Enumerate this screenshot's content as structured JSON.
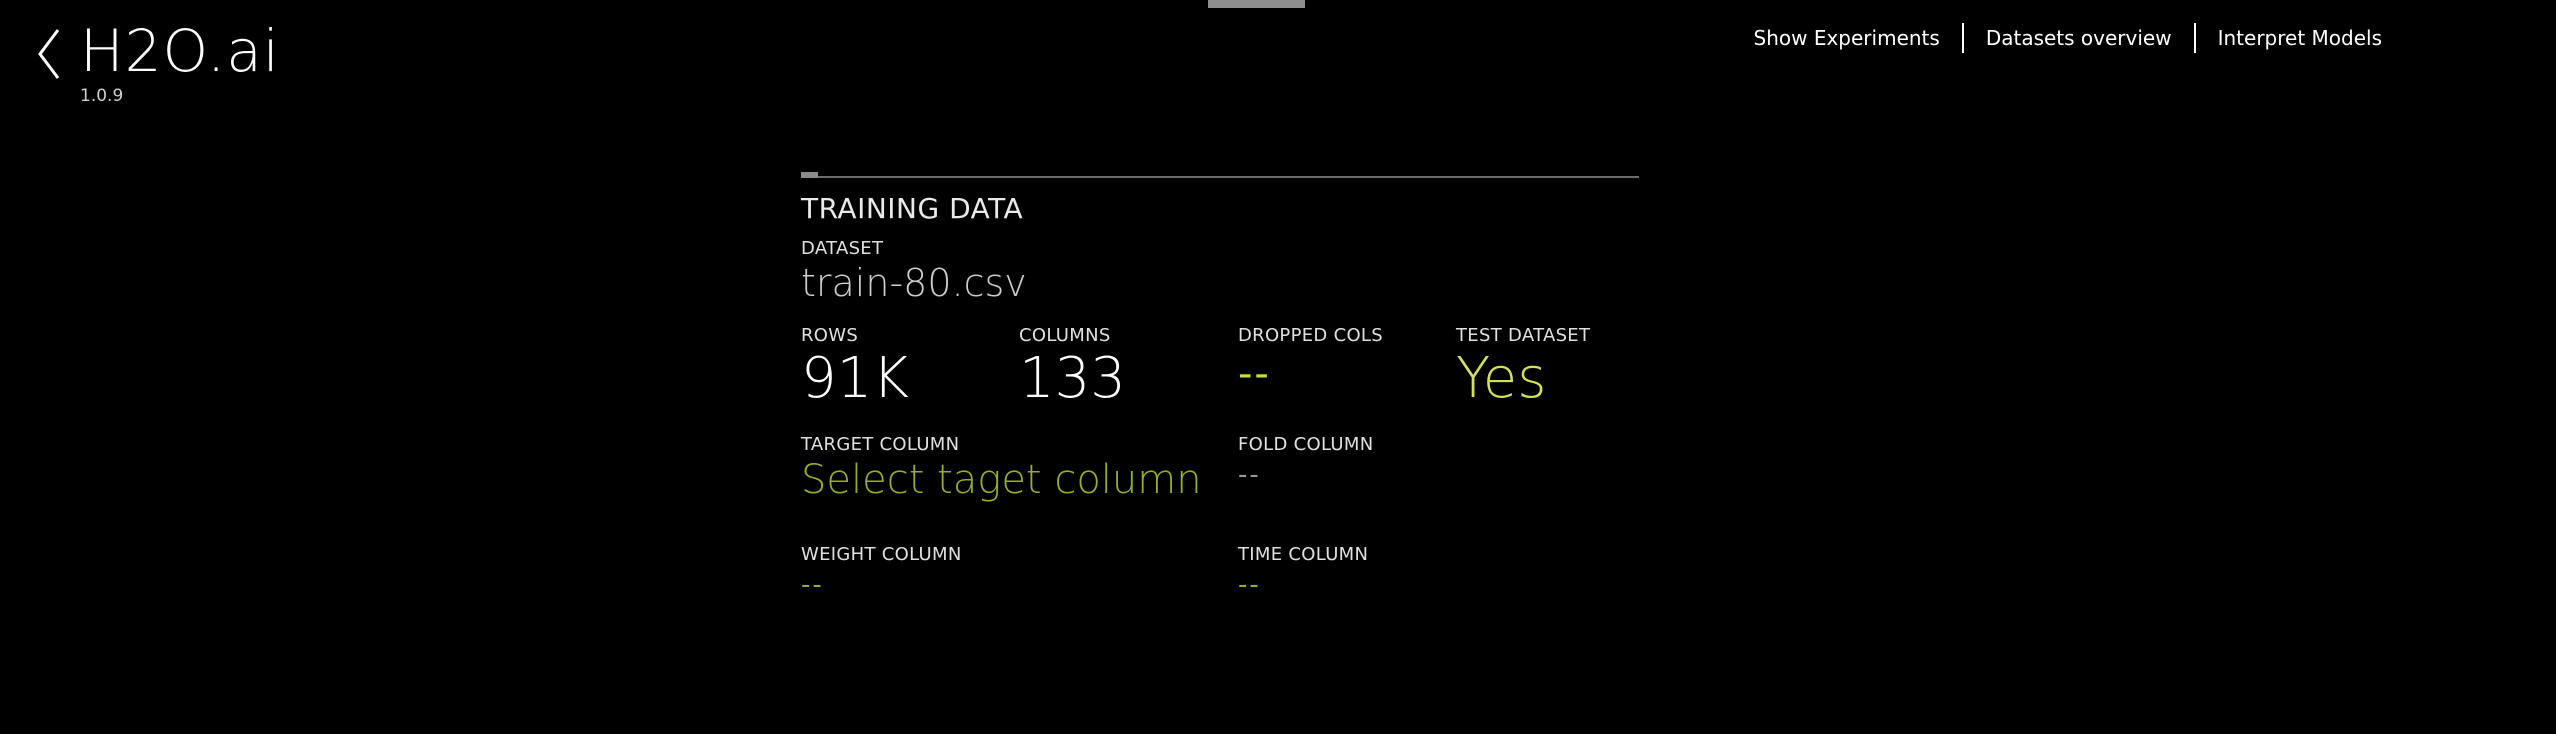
{
  "header": {
    "brand": "H2O.ai",
    "version": "1.0.9",
    "nav": [
      "Show Experiments",
      "Datasets overview",
      "Interpret Models"
    ]
  },
  "panel": {
    "progress_fraction": 0.02,
    "section_title": "TRAINING DATA",
    "dataset": {
      "label": "DATASET",
      "value": "train-80.csv"
    },
    "rows": {
      "label": "ROWS",
      "value": "91K"
    },
    "columns": {
      "label": "COLUMNS",
      "value": "133"
    },
    "dropped_cols": {
      "label": "DROPPED COLS",
      "value": "--"
    },
    "test_dataset": {
      "label": "TEST DATASET",
      "value": "Yes"
    },
    "target_column": {
      "label": "TARGET COLUMN",
      "value": "Select taget column"
    },
    "fold_column": {
      "label": "FOLD COLUMN",
      "value": "--"
    },
    "weight_column": {
      "label": "WEIGHT COLUMN",
      "value": "--"
    },
    "time_column": {
      "label": "TIME COLUMN",
      "value": "--"
    }
  },
  "colors": {
    "background": "#000000",
    "accent_yellow": "#d4e157",
    "accent_olive": "#9bab2a",
    "text": "#ffffff"
  },
  "icons": {
    "back": "chevron-left-icon"
  }
}
